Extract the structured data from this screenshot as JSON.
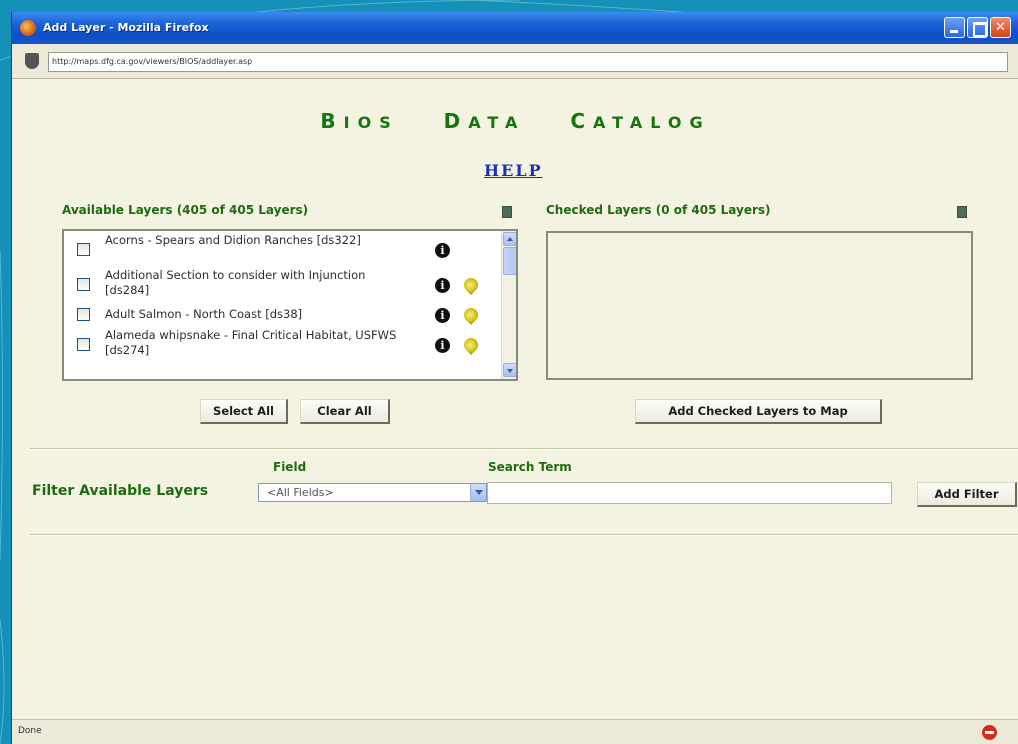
{
  "window": {
    "title": "Add Layer - Mozilla Firefox",
    "url": "http://maps.dfg.ca.gov/viewers/BIOS/addlayer.asp",
    "status": "Done"
  },
  "header": {
    "catalog_title_b": "B",
    "catalog_title_ios": "IOS",
    "catalog_title_d": "D",
    "catalog_title_ata": "ATA",
    "catalog_title_c": "C",
    "catalog_title_atalog": "ATALOG",
    "help": "HELP"
  },
  "available": {
    "label": "Available Layers (405 of 405 Layers)",
    "layers": [
      {
        "name": "Acorns - Spears and Didion Ranches [ds322]",
        "has_info": true,
        "has_pin": false
      },
      {
        "name": "Additional Section to consider with Injunction [ds284]",
        "has_info": true,
        "has_pin": true
      },
      {
        "name": "Adult Salmon - North Coast [ds38]",
        "has_info": true,
        "has_pin": true
      },
      {
        "name": "Alameda whipsnake - Final Critical Habitat, USFWS [ds274]",
        "has_info": true,
        "has_pin": true
      }
    ]
  },
  "checked": {
    "label": "Checked Layers (0 of 405 Layers)"
  },
  "buttons": {
    "select_all": "Select All",
    "clear_all": "Clear All",
    "add_checked": "Add Checked Layers to Map",
    "add_filter": "Add Filter"
  },
  "filter": {
    "label": "Filter Available Layers",
    "field_head": "Field",
    "search_head": "Search Term",
    "field_value": "<All Fields>",
    "search_value": ""
  },
  "colors": {
    "accent_green": "#17750f",
    "link_blue": "#1a2ec4",
    "panel_background": "#f4f3e1",
    "desktop_blue": "#1590b8"
  }
}
